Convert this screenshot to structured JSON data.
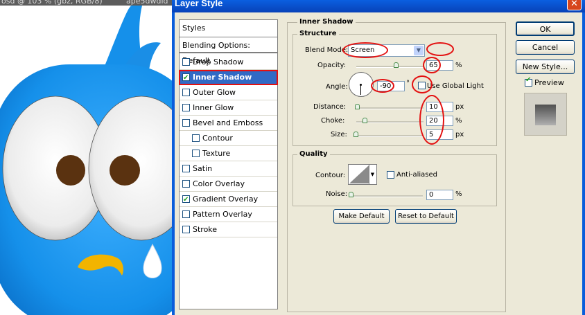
{
  "background": {
    "tabs": [
      {
        "label": "osd @ 103 % (gbz, RGB/8)"
      },
      {
        "label": "ape5dwdid"
      }
    ]
  },
  "dialog": {
    "title": "Layer Style",
    "close_glyph": "✕"
  },
  "styles_list": {
    "header": "Styles",
    "blending_options": "Blending Options: Default",
    "items": [
      {
        "label": "Drop Shadow",
        "checked": false,
        "selected": false
      },
      {
        "label": "Inner Shadow",
        "checked": true,
        "selected": true
      },
      {
        "label": "Outer Glow",
        "checked": false,
        "selected": false
      },
      {
        "label": "Inner Glow",
        "checked": false,
        "selected": false
      },
      {
        "label": "Bevel and Emboss",
        "checked": false,
        "selected": false
      },
      {
        "label": "Contour",
        "checked": false,
        "selected": false
      },
      {
        "label": "Texture",
        "checked": false,
        "selected": false
      },
      {
        "label": "Satin",
        "checked": false,
        "selected": false
      },
      {
        "label": "Color Overlay",
        "checked": false,
        "selected": false
      },
      {
        "label": "Gradient Overlay",
        "checked": true,
        "selected": false
      },
      {
        "label": "Pattern Overlay",
        "checked": false,
        "selected": false
      },
      {
        "label": "Stroke",
        "checked": false,
        "selected": false
      }
    ]
  },
  "inner_shadow": {
    "title": "Inner Shadow",
    "structure": {
      "title": "Structure",
      "blend_mode_label": "Blend Mode:",
      "blend_mode_value": "Screen",
      "opacity_label": "Opacity:",
      "opacity_value": "65",
      "opacity_unit": "%",
      "angle_label": "Angle:",
      "angle_value": "-90",
      "angle_unit": "°",
      "use_global_light_label": "Use Global Light",
      "use_global_light_checked": false,
      "distance_label": "Distance:",
      "distance_value": "10",
      "distance_unit": "px",
      "choke_label": "Choke:",
      "choke_value": "20",
      "choke_unit": "%",
      "size_label": "Size:",
      "size_value": "5",
      "size_unit": "px"
    },
    "quality": {
      "title": "Quality",
      "contour_label": "Contour:",
      "anti_aliased_label": "Anti-aliased",
      "anti_aliased_checked": false,
      "noise_label": "Noise:",
      "noise_value": "0",
      "noise_unit": "%"
    },
    "make_default_label": "Make Default",
    "reset_default_label": "Reset to Default"
  },
  "buttons": {
    "ok": "OK",
    "cancel": "Cancel",
    "new_style": "New Style...",
    "preview_label": "Preview",
    "preview_checked": true
  },
  "colors": {
    "annotation": "#e31010",
    "selection": "#316ac5",
    "bird_blue": "#1a8ee6",
    "pupil": "#5a3210",
    "beak": "#f2b400"
  }
}
